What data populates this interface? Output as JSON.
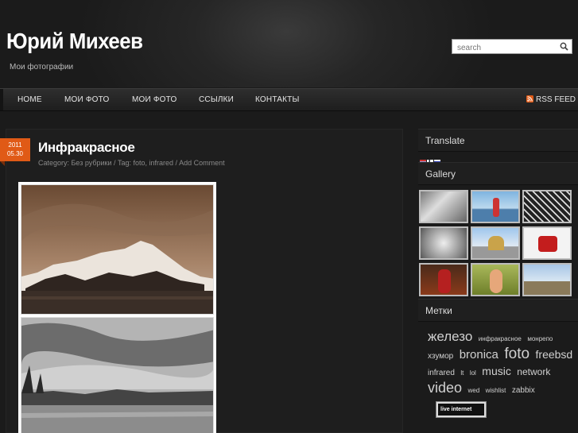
{
  "header": {
    "site_title": "Юрий Михеев",
    "site_description": "Мои фотографии",
    "search_placeholder": "search"
  },
  "nav": {
    "items": [
      "HOME",
      "МОИ ФОТО",
      "МОИ ФОТО",
      "ССЫЛКИ",
      "КОНТАКТЫ"
    ],
    "rss_label": "RSS FEED"
  },
  "post": {
    "date_year": "2011",
    "date_day": "05.30",
    "title": "Инфракрасное",
    "meta": "Category: Без рубрики / Tag: foto, infrared / Add Comment"
  },
  "sidebar": {
    "translate_title": "Translate",
    "gallery_title": "Gallery",
    "tags_title": "Метки",
    "tags": [
      {
        "label": "железо",
        "size": 17
      },
      {
        "label": "инфракрасное",
        "size": 8
      },
      {
        "label": "монрепо",
        "size": 8
      },
      {
        "label": "хзумор",
        "size": 10
      },
      {
        "label": "bronica",
        "size": 15
      },
      {
        "label": "foto",
        "size": 19
      },
      {
        "label": "freebsd",
        "size": 14
      },
      {
        "label": "infrared",
        "size": 10
      },
      {
        "label": "lt",
        "size": 8
      },
      {
        "label": "lol",
        "size": 8
      },
      {
        "label": "music",
        "size": 14
      },
      {
        "label": "network",
        "size": 12
      },
      {
        "label": "video",
        "size": 18
      },
      {
        "label": "wed",
        "size": 8
      },
      {
        "label": "wishlist",
        "size": 8
      },
      {
        "label": "zabbix",
        "size": 10
      }
    ],
    "counter_label": "live internet"
  },
  "colors": {
    "accent": "#e05a16",
    "background": "#1b1b1b"
  }
}
